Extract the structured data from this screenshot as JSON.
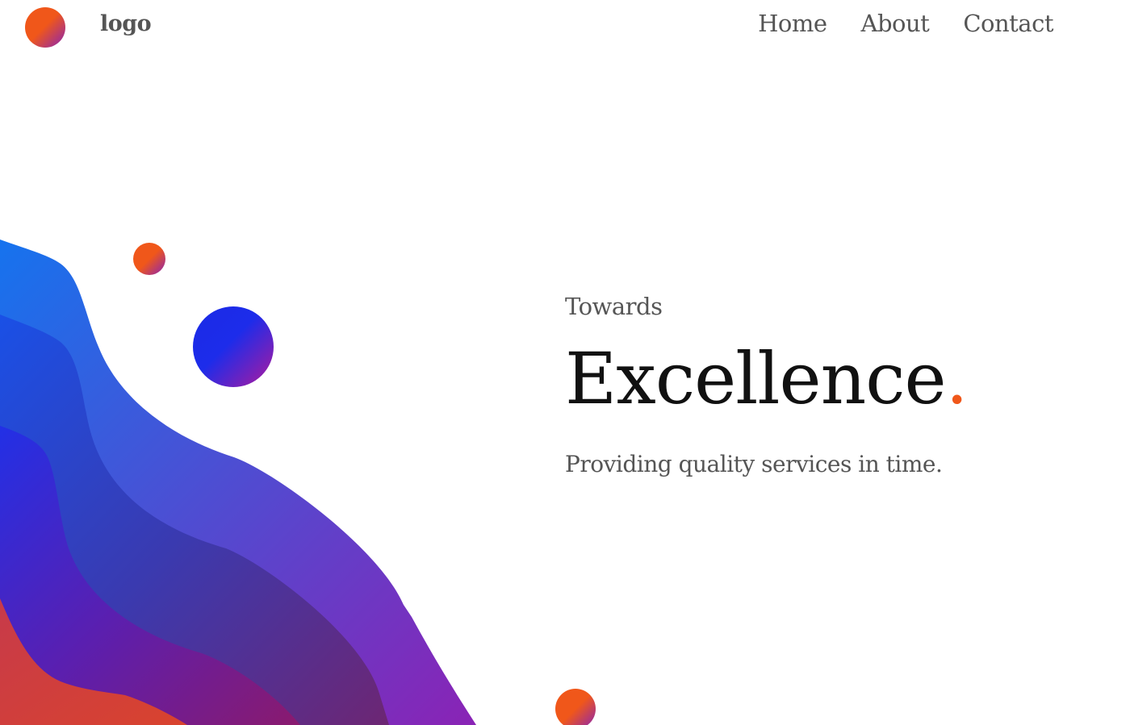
{
  "header": {
    "logo_text": "logo",
    "nav": [
      {
        "label": "Home"
      },
      {
        "label": "About"
      },
      {
        "label": "Contact"
      }
    ]
  },
  "hero": {
    "pretitle": "Towards",
    "title": "Excellence",
    "title_accent": ".",
    "subtitle": "Providing quality services in time."
  },
  "colors": {
    "accent": "#f0571a",
    "purple": "#8a23b5",
    "blue": "#1a2ae6",
    "text": "#555555",
    "title": "#111111"
  },
  "icons": {
    "logo": "logo-circle-icon"
  }
}
